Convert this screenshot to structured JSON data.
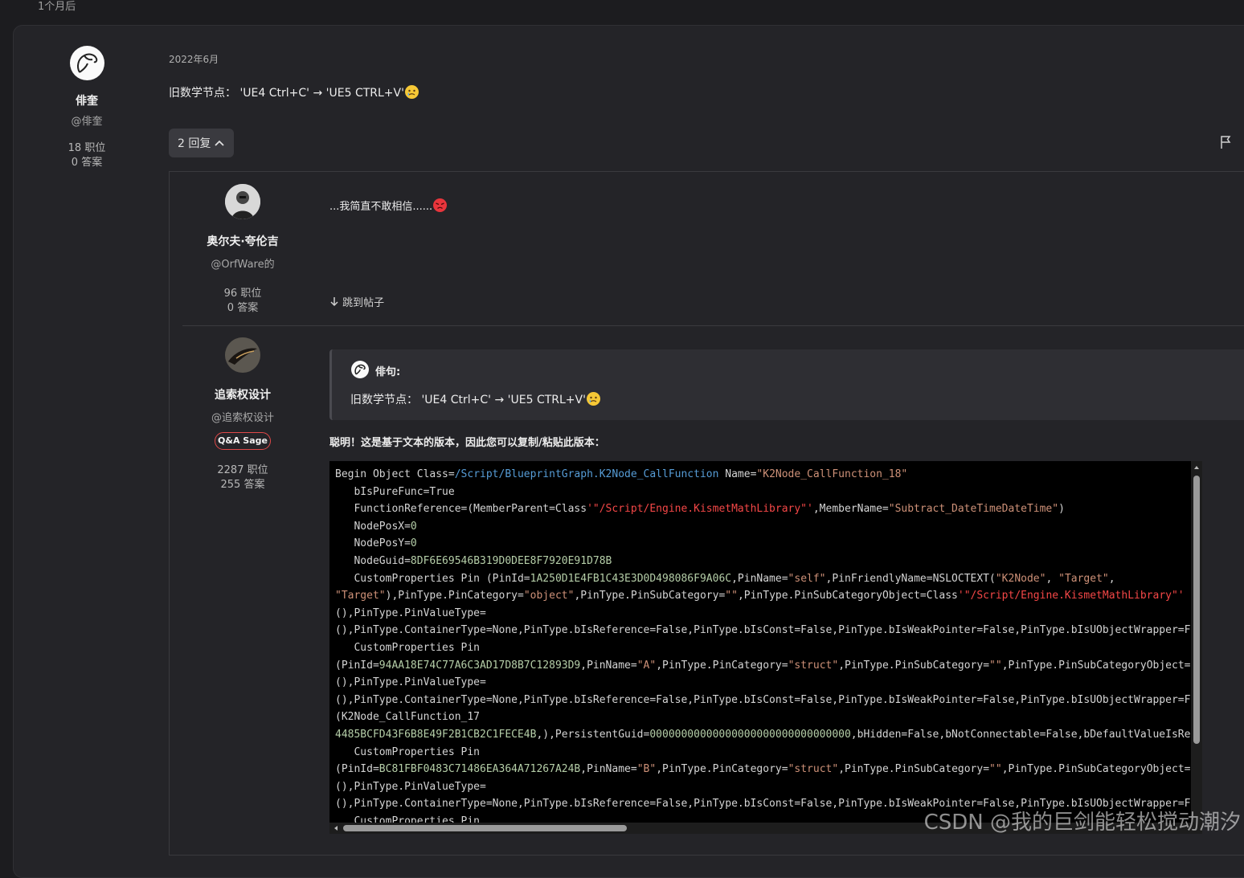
{
  "thread": {
    "time_ago": "1个月后"
  },
  "post": {
    "author": {
      "name": "俳奎",
      "handle": "@俳奎",
      "posts": "18 职位",
      "answers": "0 答案"
    },
    "date": "2022年6月",
    "body": "旧数学节点： 'UE4 Ctrl+C' → 'UE5 CTRL+V'",
    "body_emoji": "face-with-tear-emoji",
    "replies_button": "2 回复",
    "flag_icon": "flag-icon"
  },
  "replies": [
    {
      "author": {
        "name": "奥尔夫·夸伦吉",
        "handle": "@OrfWare的",
        "posts": "96 职位",
        "answers": "0 答案"
      },
      "body": "...我简直不敢相信......",
      "body_emoji": "angry-face-emoji",
      "jump_link": "跳到帖子"
    },
    {
      "author": {
        "name": "追索权设计",
        "handle": "@追索权设计",
        "badge": "Q&A Sage",
        "posts": "2287 职位",
        "answers": "255 答案"
      },
      "quote": {
        "author": "俳句:",
        "text": "旧数学节点： 'UE4 Ctrl+C' → 'UE5 CTRL+V'"
      },
      "intro": "聪明！这是基于文本的版本，因此您可以复制/粘贴此版本：",
      "code_lines": [
        [
          [
            "Begin Object Class=",
            "w"
          ],
          [
            "/Script/BlueprintGraph.K2Node_CallFunction",
            "b"
          ],
          [
            " Name=",
            "w"
          ],
          [
            "\"K2Node_CallFunction_18\"",
            "o"
          ]
        ],
        [
          [
            "   bIsPureFunc=True",
            "w"
          ]
        ],
        [
          [
            "   FunctionReference=(MemberParent=Class",
            "w"
          ],
          [
            "'\"/Script/Engine.KismetMathLibrary\"'",
            "r"
          ],
          [
            ",MemberName=",
            "w"
          ],
          [
            "\"Subtract_DateTimeDateTime\"",
            "o"
          ],
          [
            ")",
            "w"
          ]
        ],
        [
          [
            "   NodePosX=",
            "w"
          ],
          [
            "0",
            "g"
          ]
        ],
        [
          [
            "   NodePosY=",
            "w"
          ],
          [
            "0",
            "g"
          ]
        ],
        [
          [
            "   NodeGuid=",
            "w"
          ],
          [
            "8DF6E69546B319D0DEE8F7920E91D78B",
            "g"
          ]
        ],
        [
          [
            "   CustomProperties Pin (PinId=",
            "w"
          ],
          [
            "1A250D1E4FB1C43E3D0D498086F9A06C",
            "g"
          ],
          [
            ",PinName=",
            "w"
          ],
          [
            "\"self\"",
            "o"
          ],
          [
            ",PinFriendlyName=NSLOCTEXT(",
            "w"
          ],
          [
            "\"K2Node\"",
            "o"
          ],
          [
            ", ",
            "w"
          ],
          [
            "\"Target\"",
            "o"
          ],
          [
            ",",
            "w"
          ]
        ],
        [
          [
            "\"Target\"",
            "o"
          ],
          [
            "),PinType.PinCategory=",
            "w"
          ],
          [
            "\"object\"",
            "o"
          ],
          [
            ",PinType.PinSubCategory=",
            "w"
          ],
          [
            "\"\"",
            "o"
          ],
          [
            ",PinType.PinSubCategoryObject=Class",
            "w"
          ],
          [
            "'\"/Script/Engine.KismetMathLibrary\"'",
            "r"
          ]
        ],
        [
          [
            "(),PinType.PinValueType=",
            "w"
          ]
        ],
        [
          [
            "(),PinType.ContainerType=None,PinType.bIsReference=False,PinType.bIsConst=False,PinType.bIsWeakPointer=False,PinType.bIsUObjectWrapper=False",
            "w"
          ]
        ],
        [
          [
            "   CustomProperties Pin",
            "w"
          ]
        ],
        [
          [
            "(PinId=",
            "w"
          ],
          [
            "94AA18E74C77A6C3AD17D8B7C12893D9",
            "g"
          ],
          [
            ",PinName=",
            "w"
          ],
          [
            "\"A\"",
            "o"
          ],
          [
            ",PinType.PinCategory=",
            "w"
          ],
          [
            "\"struct\"",
            "o"
          ],
          [
            ",PinType.PinSubCategory=",
            "w"
          ],
          [
            "\"\"",
            "o"
          ],
          [
            ",PinType.PinSubCategoryObject=",
            "w"
          ]
        ],
        [
          [
            "(),PinType.PinValueType=",
            "w"
          ]
        ],
        [
          [
            "(),PinType.ContainerType=None,PinType.bIsReference=False,PinType.bIsConst=False,PinType.bIsWeakPointer=False,PinType.bIsUObjectWrapper=False",
            "w"
          ]
        ],
        [
          [
            "(K2Node_CallFunction_17",
            "w"
          ]
        ],
        [
          [
            "4485BCFD43F6B8E49F2B1CB2C1FECE4B",
            "g"
          ],
          [
            ",),PersistentGuid=",
            "w"
          ],
          [
            "00000000000000000000000000000000",
            "g"
          ],
          [
            ",bHidden=False,bNotConnectable=False,bDefaultValueIsReadOnly=False",
            "w"
          ]
        ],
        [
          [
            "   CustomProperties Pin",
            "w"
          ]
        ],
        [
          [
            "(PinId=",
            "w"
          ],
          [
            "BC81FBF0483C71486EA364A71267A24B",
            "g"
          ],
          [
            ",PinName=",
            "w"
          ],
          [
            "\"B\"",
            "o"
          ],
          [
            ",PinType.PinCategory=",
            "w"
          ],
          [
            "\"struct\"",
            "o"
          ],
          [
            ",PinType.PinSubCategory=",
            "w"
          ],
          [
            "\"\"",
            "o"
          ],
          [
            ",PinType.PinSubCategoryObject=",
            "w"
          ]
        ],
        [
          [
            "(),PinType.PinValueType=",
            "w"
          ]
        ],
        [
          [
            "(),PinType.ContainerType=None,PinType.bIsReference=False,PinType.bIsConst=False,PinType.bIsWeakPointer=False,PinType.bIsUObjectWrapper=False",
            "w"
          ]
        ],
        [
          [
            "   CustomProperties Pin",
            "w"
          ]
        ]
      ]
    }
  ],
  "code_colors": {
    "w": "#d4d4d4",
    "b": "#569cd6",
    "o": "#ce9178",
    "r": "#f44747",
    "g": "#b5cea8"
  },
  "watermark": "CSDN @我的巨剑能轻松搅动潮汐"
}
